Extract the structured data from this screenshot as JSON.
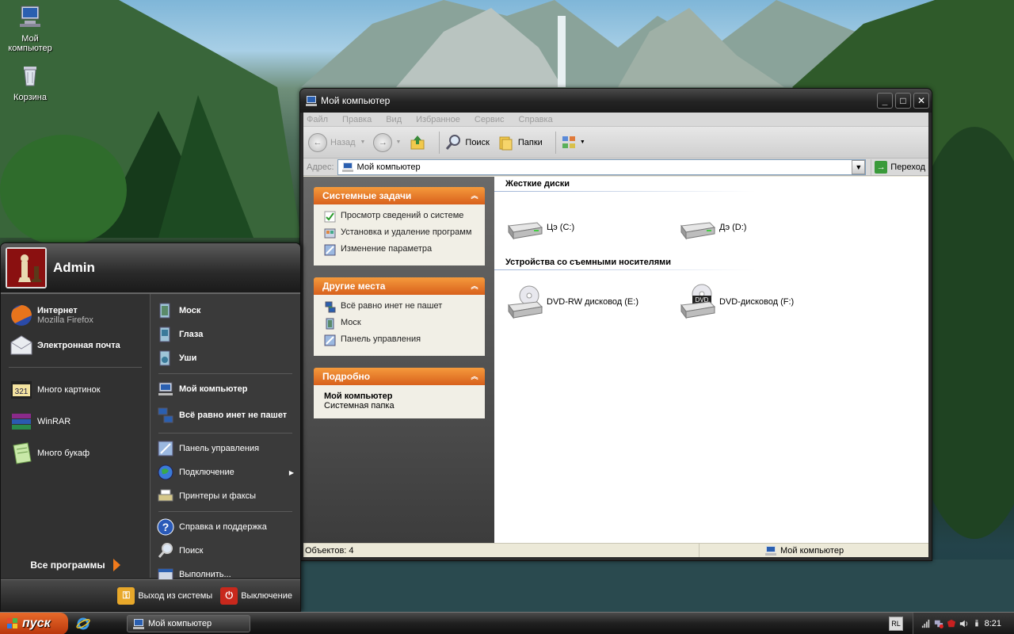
{
  "desktop": {
    "icons": [
      {
        "label": "Мой компьютер",
        "icon": "computer-icon"
      },
      {
        "label": "Корзина",
        "icon": "recycle-bin-icon"
      }
    ]
  },
  "explorer": {
    "title": "Мой компьютер",
    "menu": [
      "Файл",
      "Правка",
      "Вид",
      "Избранное",
      "Сервис",
      "Справка"
    ],
    "toolbar": {
      "back": "Назад",
      "search": "Поиск",
      "folders": "Папки"
    },
    "address": {
      "label": "Адрес:",
      "value": "Мой компьютер",
      "go": "Переход"
    },
    "taskpane": {
      "system_tasks": {
        "title": "Системные задачи",
        "items": [
          "Просмотр сведений о системе",
          "Установка и удаление программ",
          "Изменение параметра"
        ]
      },
      "other_places": {
        "title": "Другие места",
        "items": [
          "Всё равно инет не пашет",
          "Моск",
          "Панель управления"
        ]
      },
      "details": {
        "title": "Подробно",
        "name": "Мой компьютер",
        "type": "Системная папка"
      }
    },
    "groups": {
      "hard_drives": {
        "title": "Жесткие диски",
        "drives": [
          "Цэ (C:)",
          "Дэ (D:)"
        ]
      },
      "removable": {
        "title": "Устройства со съемными носителями",
        "drives": [
          "DVD-RW дисковод (E:)",
          "DVD-дисковод (F:)"
        ],
        "dvd_badge": "DVD"
      }
    },
    "status": {
      "count": "Объектов: 4",
      "location": "Мой компьютер"
    }
  },
  "startmenu": {
    "user": "Admin",
    "pinned": [
      {
        "title": "Интернет",
        "subtitle": "Mozilla Firefox"
      },
      {
        "title": "Электронная почта"
      }
    ],
    "recent": [
      "Много картинок",
      "WinRAR",
      "Много букаф"
    ],
    "all_programs": "Все программы",
    "right": [
      "Моск",
      "Глаза",
      "Уши",
      "Мой компьютер",
      "Всё равно инет не пашет",
      "Панель управления",
      "Подключение",
      "Принтеры и факсы",
      "Справка и поддержка",
      "Поиск",
      "Выполнить..."
    ],
    "logoff": "Выход из системы",
    "shutdown": "Выключение"
  },
  "taskbar": {
    "start_label": "пуск",
    "task": "Мой компьютер",
    "lang": "RL",
    "clock": "8:21"
  }
}
